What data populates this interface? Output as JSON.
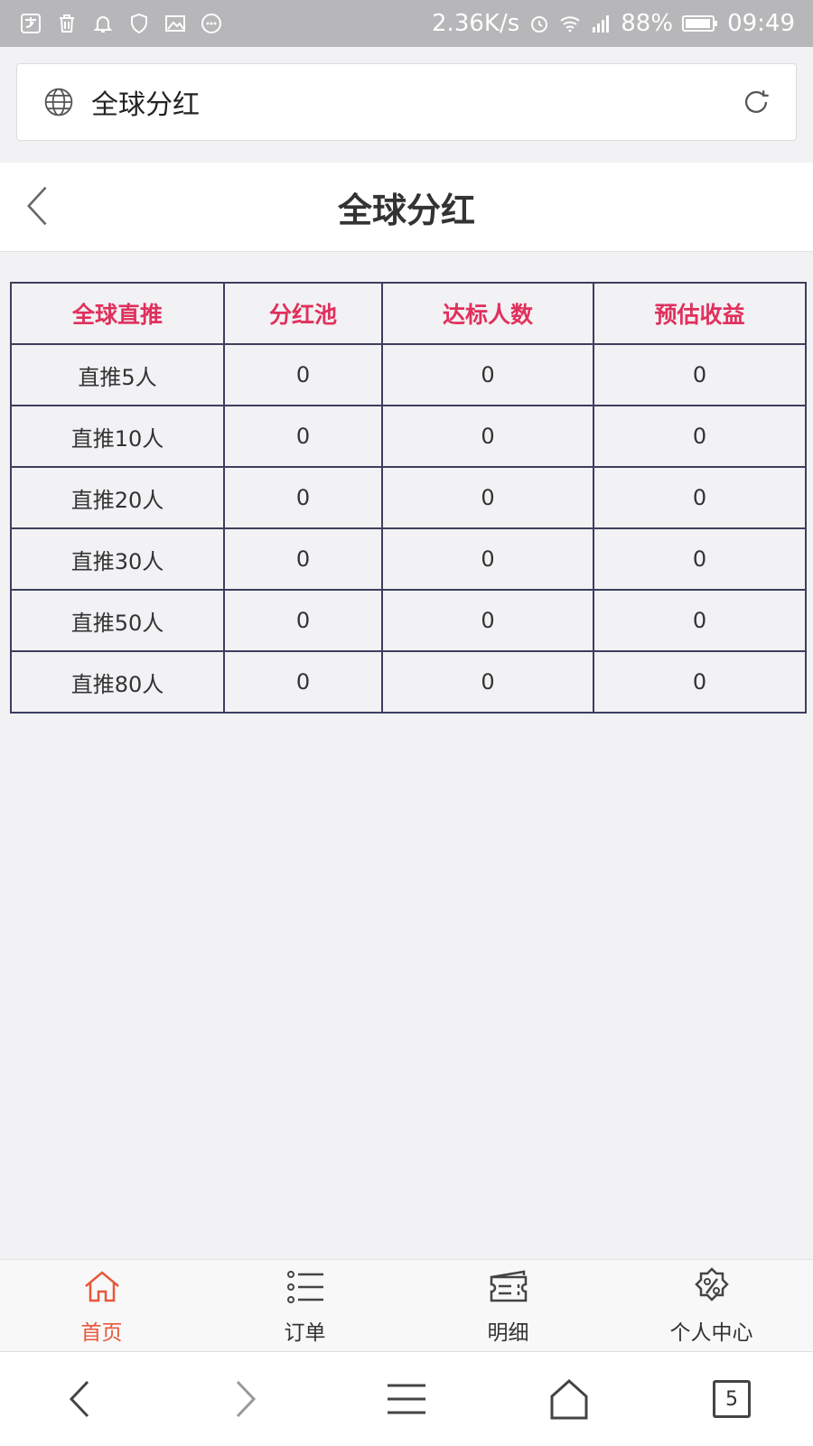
{
  "status_bar": {
    "speed": "2.36K/s",
    "battery": "88%",
    "time": "09:49"
  },
  "address_bar": {
    "title": "全球分红"
  },
  "page": {
    "title": "全球分红"
  },
  "table": {
    "headers": [
      "全球直推",
      "分红池",
      "达标人数",
      "预估收益"
    ],
    "rows": [
      [
        "直推5人",
        "0",
        "0",
        "0"
      ],
      [
        "直推10人",
        "0",
        "0",
        "0"
      ],
      [
        "直推20人",
        "0",
        "0",
        "0"
      ],
      [
        "直推30人",
        "0",
        "0",
        "0"
      ],
      [
        "直推50人",
        "0",
        "0",
        "0"
      ],
      [
        "直推80人",
        "0",
        "0",
        "0"
      ]
    ]
  },
  "tabbar": {
    "items": [
      {
        "label": "首页",
        "icon": "home-icon",
        "active": true
      },
      {
        "label": "订单",
        "icon": "list-icon",
        "active": false
      },
      {
        "label": "明细",
        "icon": "ticket-icon",
        "active": false
      },
      {
        "label": "个人中心",
        "icon": "percent-badge-icon",
        "active": false
      }
    ]
  },
  "browser_nav": {
    "tab_count": "5"
  },
  "colors": {
    "accent": "#e0305c",
    "active_tab": "#e8573a",
    "table_border": "#3c3f5c"
  }
}
